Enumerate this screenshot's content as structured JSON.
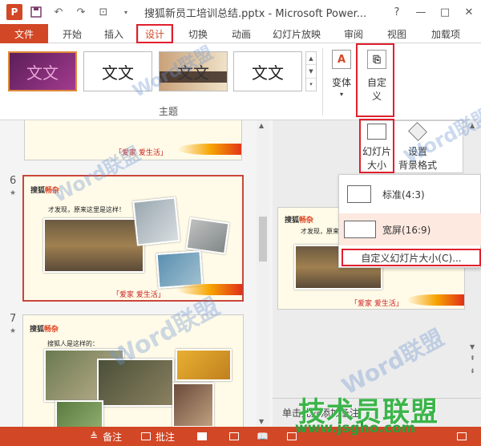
{
  "window": {
    "app_icon": "P",
    "title": "搜狐新员工培训总结.pptx - Microsoft Power...",
    "controls": [
      "?",
      "—",
      "□",
      "✕"
    ]
  },
  "quick_access": {
    "save": "save-icon",
    "undo": "undo-icon",
    "redo": "redo-icon",
    "present": "present-icon"
  },
  "tabs": [
    {
      "label": "文件"
    },
    {
      "label": "开始"
    },
    {
      "label": "插入"
    },
    {
      "label": "设计"
    },
    {
      "label": "切换"
    },
    {
      "label": "动画"
    },
    {
      "label": "幻灯片放映"
    },
    {
      "label": "审阅"
    },
    {
      "label": "视图"
    },
    {
      "label": "加载项"
    }
  ],
  "ribbon": {
    "themes": [
      {
        "text": "文文"
      },
      {
        "text": "文文"
      },
      {
        "text": "文文"
      },
      {
        "text": "文文"
      }
    ],
    "group_label": "主题",
    "variant_label": "变体",
    "variant_icon": "A",
    "customize_label_1": "自定",
    "customize_label_2": "义"
  },
  "customize_group": {
    "slide_size_label_1": "幻灯片",
    "slide_size_label_2": "大小",
    "bg_format_label_1": "设置",
    "bg_format_label_2": "背景格式"
  },
  "dropdown": {
    "standard": "标准(4:3)",
    "widescreen": "宽屏(16:9)",
    "custom": "自定义幻灯片大小(C)..."
  },
  "slides": [
    {
      "number": "",
      "footer": "「爱家 爱生活」"
    },
    {
      "number": "6",
      "star": "★",
      "logo_a": "搜狐",
      "logo_b": "畅杂",
      "heading": "才发现，原来这里是这样！",
      "footer": "「爱家 爱生活」"
    },
    {
      "number": "7",
      "star": "★",
      "logo_a": "搜狐",
      "logo_b": "畅杂",
      "heading": "搜狐人是这样的："
    }
  ],
  "preview": {
    "logo_a": "搜狐",
    "logo_b": "畅杂",
    "heading": "才发现，原来这里是这样！",
    "footer": "「爱家 爱生活」"
  },
  "notes_placeholder": "单击此处添加备注",
  "status": {
    "notes": "备注",
    "comments": "批注"
  },
  "watermarks": {
    "word": "Word联盟",
    "site_cn": "技术员联盟",
    "site_url": "www.jsgho.com"
  },
  "colors": {
    "accent": "#d24726",
    "highlight": "#e0202d"
  }
}
